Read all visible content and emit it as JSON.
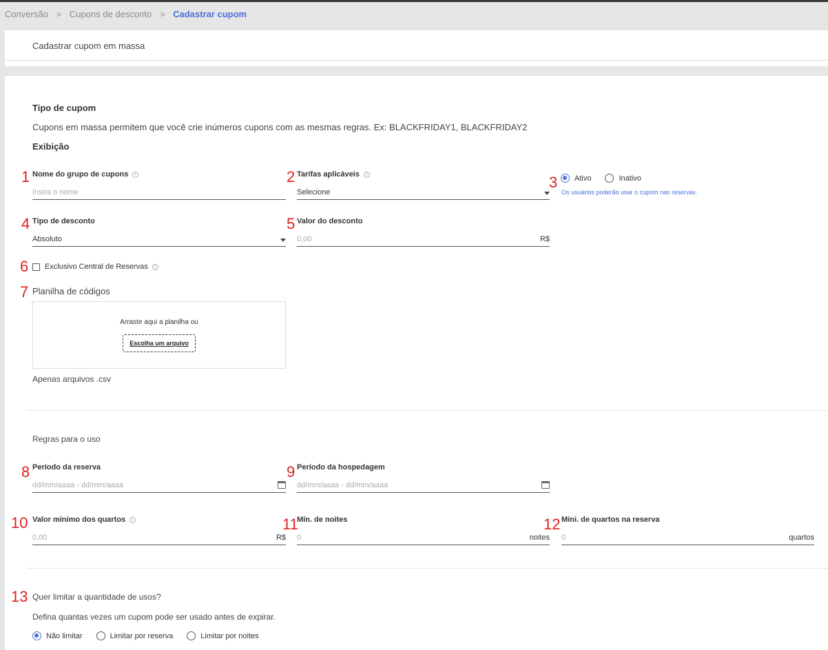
{
  "breadcrumb": {
    "item1": "Conversão",
    "item2": "Cupons de desconto",
    "current": "Cadastrar cupom",
    "separator": ">"
  },
  "header": {
    "title": "Cadastrar cupom em massa"
  },
  "tipo": {
    "title": "Tipo de cupom",
    "description": "Cupons em massa permitem que você crie inúmeros cupons com as mesmas regras. Ex: BLACKFRIDAY1, BLACKFRIDAY2",
    "exibicao": "Exibição"
  },
  "numbers": [
    "1",
    "2",
    "3",
    "4",
    "5",
    "6",
    "7",
    "8",
    "9",
    "10",
    "11",
    "12",
    "13"
  ],
  "fields": {
    "nome_grupo": {
      "label": "Nome do grupo de cupons",
      "placeholder": "Insira o nome"
    },
    "tarifas": {
      "label": "Tarifas aplicáveis",
      "placeholder": "Selecione"
    },
    "status": {
      "ativo": "Ativo",
      "inativo": "Inativo",
      "selected": "Ativo",
      "hint": "Os usuários poderão usar o cupom nas reservas."
    },
    "tipo_desconto": {
      "label": "Tipo de desconto",
      "value": "Absoluto"
    },
    "valor_desconto": {
      "label": "Valor do desconto",
      "placeholder": "0,00",
      "suffix": "R$"
    },
    "exclusivo": {
      "label": "Exclusivo Central de Reservas"
    },
    "planilha": {
      "label": "Planilha de códigos",
      "drop_text": "Arraste aqui a planilha ou",
      "button": "Escolha um arquivo",
      "note": "Apenas arquivos .csv"
    }
  },
  "regras": {
    "title": "Regras para o uso",
    "periodo_reserva": {
      "label": "Período da reserva",
      "placeholder": "dd/mm/aaaa - dd/mm/aaaa"
    },
    "periodo_hospedagem": {
      "label": "Período da hospedagem",
      "placeholder": "dd/mm/aaaa - dd/mm/aaaa"
    },
    "valor_minimo": {
      "label": "Valor mínimo dos quartos",
      "placeholder": "0,00",
      "suffix": "R$"
    },
    "min_noites": {
      "label": "Mín. de noites",
      "placeholder": "0",
      "suffix": "noites"
    },
    "min_quartos": {
      "label": "Míni. de quartos na reserva",
      "placeholder": "0",
      "suffix": "quartos"
    }
  },
  "limite": {
    "question": "Quer limitar a quantidade de usos?",
    "description": "Defina quantas vezes um cupom pode ser usado antes de expirar.",
    "options": [
      "Não limitar",
      "Limitar por reserva",
      "Limitar por noites"
    ],
    "selected": "Não limitar"
  },
  "colors": {
    "accent": "#4a6fdc",
    "annotation": "#e01e1e"
  }
}
